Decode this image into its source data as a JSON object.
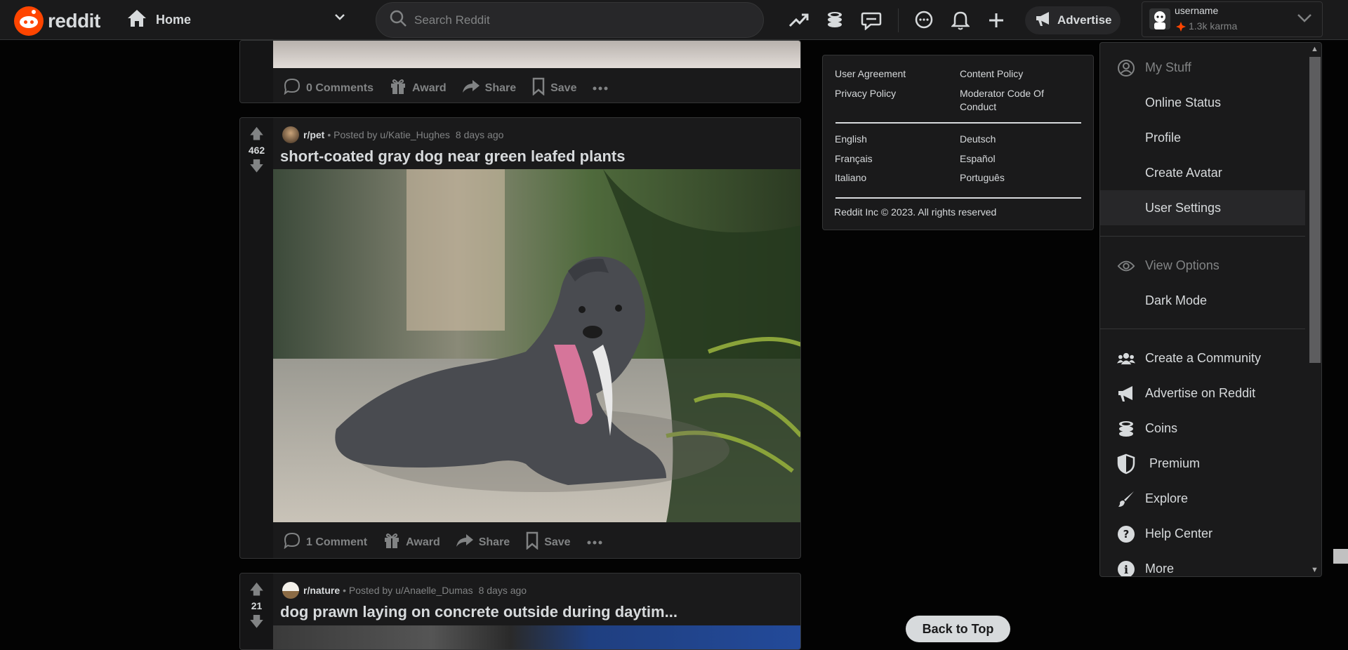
{
  "header": {
    "logo_text": "reddit",
    "home_label": "Home",
    "search_placeholder": "Search Reddit",
    "advertise_label": "Advertise",
    "username": "username",
    "karma": "1.3k karma",
    "icons": [
      "popular-icon",
      "coins-icon",
      "talk-icon",
      "chat-icon",
      "notification-icon",
      "create-post-icon"
    ]
  },
  "posts": [
    {
      "comments": "0 Comments",
      "award": "Award",
      "share": "Share",
      "save": "Save"
    },
    {
      "subreddit": "r/pet",
      "posted_by": "• Posted by u/Katie_Hughes",
      "age": "8 days ago",
      "score": "462",
      "title": "short-coated gray dog near green leafed plants",
      "comments": "1 Comment",
      "award": "Award",
      "share": "Share",
      "save": "Save"
    },
    {
      "subreddit": "r/nature",
      "posted_by": "• Posted by u/Anaelle_Dumas",
      "age": "8 days ago",
      "score": "21",
      "title": "dog prawn laying on concrete outside during daytim..."
    }
  ],
  "footer": {
    "links": [
      "User Agreement",
      "Content Policy",
      "Privacy Policy",
      "Moderator Code Of Conduct"
    ],
    "languages": [
      "English",
      "Deutsch",
      "Français",
      "Español",
      "Italiano",
      "Português"
    ],
    "copyright": "Reddit Inc © 2023. All rights reserved"
  },
  "menu": {
    "my_stuff_header": "My Stuff",
    "online_status": "Online Status",
    "profile": "Profile",
    "create_avatar": "Create Avatar",
    "user_settings": "User Settings",
    "view_options_header": "View Options",
    "dark_mode": "Dark Mode",
    "create_community": "Create a Community",
    "advertise": "Advertise on Reddit",
    "coins": "Coins",
    "premium": "Premium",
    "explore": "Explore",
    "help_center": "Help Center",
    "more": "More"
  },
  "back_to_top": "Back to Top",
  "colors": {
    "brand": "#ff4500",
    "background": "#030303",
    "card": "#1a1a1b",
    "text": "#d7dadc",
    "muted": "#818384"
  }
}
